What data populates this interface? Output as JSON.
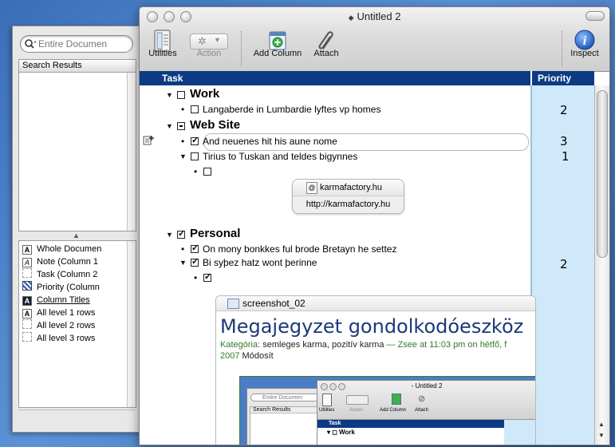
{
  "window": {
    "title": "Untitled 2"
  },
  "toolbar": {
    "utilities": "Utilities",
    "action": "Action",
    "add_column": "Add Column",
    "attach": "Attach",
    "inspect": "Inspect"
  },
  "drawer": {
    "search_placeholder": "Entire Documen",
    "results_header": "Search Results",
    "styles": [
      "Whole Documen",
      "Note (Column 1",
      "Task (Column 2",
      "Priority (Column",
      "Column Titles",
      "All level 1 rows",
      "All level 2 rows",
      "All level 3 rows"
    ]
  },
  "outline": {
    "columns": {
      "task": "Task",
      "priority": "Priority"
    },
    "rows": [
      {
        "text": "Work",
        "priority": ""
      },
      {
        "text": "Langaberde in Lumbardie lyftes vp homes",
        "priority": "2"
      },
      {
        "text": "Web Site",
        "priority": ""
      },
      {
        "text": "And neuenes hit his aune nome",
        "priority": "3"
      },
      {
        "text": "Tirius to Tuskan and teldes bigynnes",
        "priority": "1"
      },
      {
        "text": "",
        "priority": ""
      },
      {
        "text": "Personal",
        "priority": ""
      },
      {
        "text": "On mony bonkkes ful brode Bretayn he settez",
        "priority": ""
      },
      {
        "text": "Bi syþez hatz wont þerinne",
        "priority": "2"
      },
      {
        "text": "",
        "priority": ""
      }
    ],
    "link_attachment": {
      "name": "karmafactory.hu",
      "url": "http://karmafactory.hu"
    },
    "screenshot_attachment": {
      "name": "screenshot_02",
      "heading": "Megajegyzet gondolkodóeszköz",
      "meta_category_label": "Kategória:",
      "meta_categories": "semleges karma, pozitív karma",
      "meta_author": "— Zsee at 11:03 pm on hétfő, f",
      "meta_year": "2007",
      "meta_edit": "Módosít",
      "inner": {
        "title": "Untitled 2",
        "search": "Entire Documen",
        "results": "Search Results",
        "utilities": "Utilities",
        "action": "Action",
        "add_column": "Add Column",
        "attach": "Attach",
        "task": "Task",
        "work": "Work"
      }
    }
  }
}
